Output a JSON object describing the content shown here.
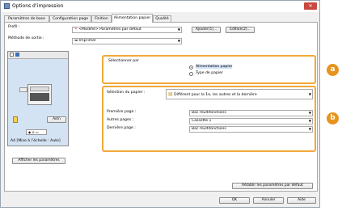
{
  "window": {
    "title": "Options d’impression",
    "close": "✕"
  },
  "tabs": [
    {
      "label": "Paramètres de base",
      "active": false
    },
    {
      "label": "Configuration page",
      "active": false
    },
    {
      "label": "Finition",
      "active": false
    },
    {
      "label": "Alimentation papier",
      "active": true
    },
    {
      "label": "Qualité",
      "active": false
    }
  ],
  "profile": {
    "label": "Profil :",
    "value": "<Modifié> Paramètres par défaut",
    "add_button": "Ajouter(1)...",
    "edit_button": "Edition(2)..."
  },
  "output": {
    "label": "Méthode de sortie :",
    "value": "Imprimer"
  },
  "preview": {
    "button": "Avtn",
    "caption": "A4 [Mise à l’échelle : Auto]"
  },
  "select_by": {
    "label": "Sélectionner par",
    "options": [
      {
        "label": "Alimentation papier",
        "checked": true
      },
      {
        "label": "Type de papier",
        "checked": false
      }
    ],
    "badge": "a"
  },
  "paper_selection": {
    "label": "Sélection du papier :",
    "value": "Différent pour la 1e, les autres et la dernière",
    "badge": "b",
    "rows": [
      {
        "label": "Première page :",
        "value": "Bac multifonctions"
      },
      {
        "label": "Autres pages :",
        "value": "Cassette 1"
      },
      {
        "label": "Dernière page :",
        "value": "Bac multifonctions"
      }
    ]
  },
  "buttons": {
    "show_settings": "Afficher les paramètres",
    "restore_defaults": "Rétablir les paramètres par défaut",
    "ok": "OK",
    "cancel": "Annuler",
    "help": "Aide"
  },
  "colors": {
    "highlight": "#f2a93b",
    "badge": "#e8931c"
  }
}
